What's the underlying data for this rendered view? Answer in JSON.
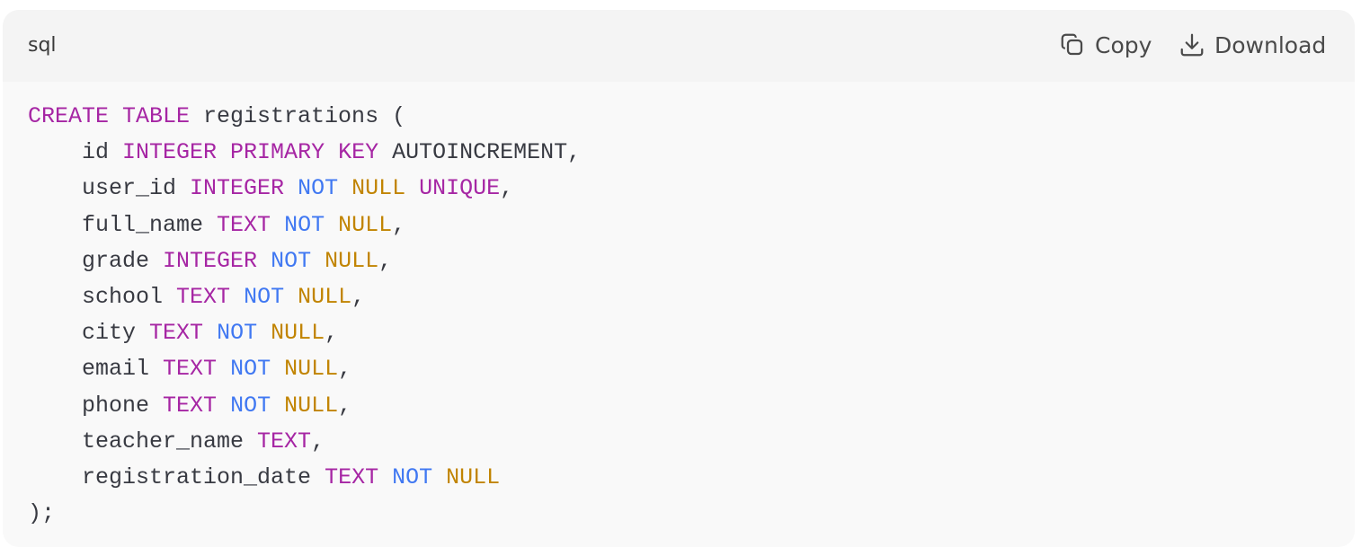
{
  "header": {
    "language": "sql",
    "copy_label": "Copy",
    "download_label": "Download",
    "copy_icon": "copy-icon",
    "download_icon": "download-icon"
  },
  "colors": {
    "keyword": "#a626a4",
    "not": "#4078f2",
    "null": "#c18401",
    "text": "#383a42"
  },
  "code": {
    "lines": [
      [
        [
          "CREATE TABLE",
          "kw"
        ],
        [
          " registrations (",
          "tx"
        ]
      ],
      [
        [
          "    id ",
          "tx"
        ],
        [
          "INTEGER PRIMARY KEY",
          "kw"
        ],
        [
          " AUTOINCREMENT,",
          "tx"
        ]
      ],
      [
        [
          "    user_id ",
          "tx"
        ],
        [
          "INTEGER",
          "kw"
        ],
        [
          " ",
          "tx"
        ],
        [
          "NOT",
          "nt"
        ],
        [
          " ",
          "tx"
        ],
        [
          "NULL",
          "nl"
        ],
        [
          " ",
          "tx"
        ],
        [
          "UNIQUE",
          "kw"
        ],
        [
          ",",
          "tx"
        ]
      ],
      [
        [
          "    full_name ",
          "tx"
        ],
        [
          "TEXT",
          "kw"
        ],
        [
          " ",
          "tx"
        ],
        [
          "NOT",
          "nt"
        ],
        [
          " ",
          "tx"
        ],
        [
          "NULL",
          "nl"
        ],
        [
          ",",
          "tx"
        ]
      ],
      [
        [
          "    grade ",
          "tx"
        ],
        [
          "INTEGER",
          "kw"
        ],
        [
          " ",
          "tx"
        ],
        [
          "NOT",
          "nt"
        ],
        [
          " ",
          "tx"
        ],
        [
          "NULL",
          "nl"
        ],
        [
          ",",
          "tx"
        ]
      ],
      [
        [
          "    school ",
          "tx"
        ],
        [
          "TEXT",
          "kw"
        ],
        [
          " ",
          "tx"
        ],
        [
          "NOT",
          "nt"
        ],
        [
          " ",
          "tx"
        ],
        [
          "NULL",
          "nl"
        ],
        [
          ",",
          "tx"
        ]
      ],
      [
        [
          "    city ",
          "tx"
        ],
        [
          "TEXT",
          "kw"
        ],
        [
          " ",
          "tx"
        ],
        [
          "NOT",
          "nt"
        ],
        [
          " ",
          "tx"
        ],
        [
          "NULL",
          "nl"
        ],
        [
          ",",
          "tx"
        ]
      ],
      [
        [
          "    email ",
          "tx"
        ],
        [
          "TEXT",
          "kw"
        ],
        [
          " ",
          "tx"
        ],
        [
          "NOT",
          "nt"
        ],
        [
          " ",
          "tx"
        ],
        [
          "NULL",
          "nl"
        ],
        [
          ",",
          "tx"
        ]
      ],
      [
        [
          "    phone ",
          "tx"
        ],
        [
          "TEXT",
          "kw"
        ],
        [
          " ",
          "tx"
        ],
        [
          "NOT",
          "nt"
        ],
        [
          " ",
          "tx"
        ],
        [
          "NULL",
          "nl"
        ],
        [
          ",",
          "tx"
        ]
      ],
      [
        [
          "    teacher_name ",
          "tx"
        ],
        [
          "TEXT",
          "kw"
        ],
        [
          ",",
          "tx"
        ]
      ],
      [
        [
          "    registration_date ",
          "tx"
        ],
        [
          "TEXT",
          "kw"
        ],
        [
          " ",
          "tx"
        ],
        [
          "NOT",
          "nt"
        ],
        [
          " ",
          "tx"
        ],
        [
          "NULL",
          "nl"
        ]
      ],
      [
        [
          ");",
          "tx"
        ]
      ]
    ]
  }
}
